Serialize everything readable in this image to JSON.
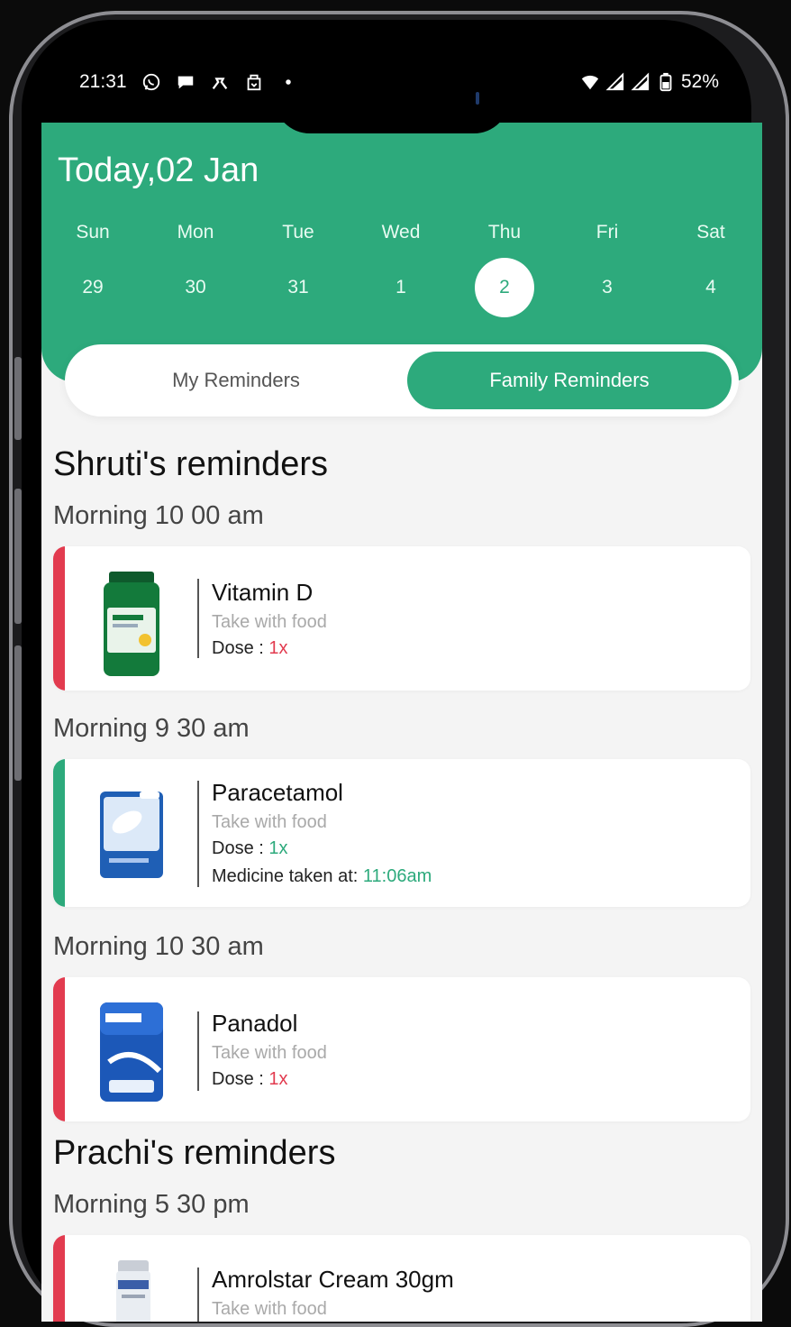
{
  "status_bar": {
    "time": "21:31",
    "battery": "52%",
    "left_icons": [
      "whatsapp-icon",
      "chat-bubble-icon",
      "app-icon",
      "app-icon-2",
      "dot-icon"
    ],
    "right_icons": [
      "wifi-icon",
      "signal-icon",
      "signal-icon-2",
      "battery-icon"
    ]
  },
  "header": {
    "title": "Today,02 Jan",
    "days": [
      {
        "name": "Sun",
        "num": "29"
      },
      {
        "name": "Mon",
        "num": "30"
      },
      {
        "name": "Tue",
        "num": "31"
      },
      {
        "name": "Wed",
        "num": "1"
      },
      {
        "name": "Thu",
        "num": "2",
        "selected": true
      },
      {
        "name": "Fri",
        "num": "3"
      },
      {
        "name": "Sat",
        "num": "4"
      }
    ]
  },
  "tabs": {
    "my": "My Reminders",
    "family": "Family Reminders",
    "active": "family"
  },
  "sections": [
    {
      "title": "Shruti's reminders",
      "groups": [
        {
          "time": "Morning 10 00 am",
          "name": "Vitamin D",
          "note": "Take with food",
          "dose_label": "Dose : ",
          "dose": "1x",
          "status": "missed"
        },
        {
          "time": "Morning 9 30 am",
          "name": "Paracetamol",
          "note": "Take with food",
          "dose_label": "Dose : ",
          "dose": "1x",
          "status": "taken",
          "taken_label": "Medicine taken at: ",
          "taken_time": "11:06am"
        },
        {
          "time": "Morning 10 30 am",
          "name": "Panadol",
          "note": "Take with food",
          "dose_label": "Dose : ",
          "dose": "1x",
          "status": "missed"
        }
      ]
    },
    {
      "title": "Prachi's reminders",
      "groups": [
        {
          "time": "Morning 5 30 pm",
          "name": "Amrolstar Cream 30gm",
          "note": "Take with food",
          "status": "missed"
        }
      ]
    }
  ],
  "colors": {
    "accent": "#2daa7c",
    "missed": "#e23b4f",
    "background": "#f4f4f4"
  }
}
